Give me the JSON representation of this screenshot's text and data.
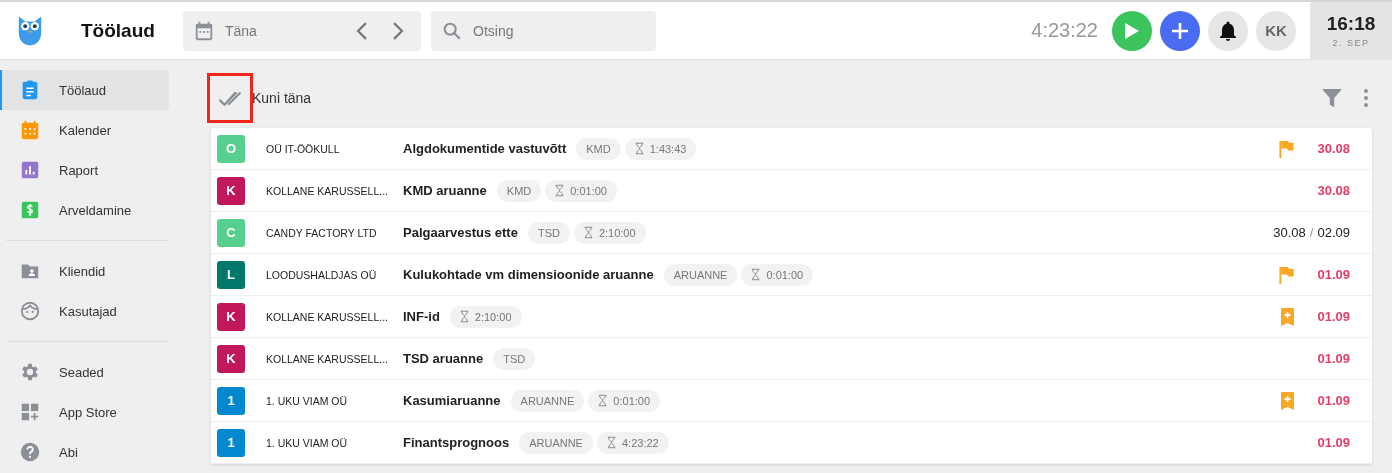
{
  "header": {
    "title": "Töölaud",
    "date_field": {
      "value": "Täna"
    },
    "search": {
      "placeholder": "Otsing"
    },
    "timer": "4:23:22",
    "user_initials": "KK",
    "clock": {
      "time": "16:18",
      "date": "2. SEP"
    }
  },
  "sidebar": {
    "groups": [
      [
        {
          "label": "Töölaud",
          "selected": true
        },
        {
          "label": "Kalender",
          "selected": false
        },
        {
          "label": "Raport",
          "selected": false
        },
        {
          "label": "Arveldamine",
          "selected": false
        }
      ],
      [
        {
          "label": "Kliendid",
          "selected": false
        },
        {
          "label": "Kasutajad",
          "selected": false
        }
      ],
      [
        {
          "label": "Seaded",
          "selected": false
        },
        {
          "label": "App Store",
          "selected": false
        },
        {
          "label": "Abi",
          "selected": false
        }
      ]
    ]
  },
  "toolbar": {
    "label": "Kuni täna",
    "highlighted": true
  },
  "date_separator": "/",
  "tasks": [
    {
      "avatar": "O",
      "color": "#57d08f",
      "client": "OÜ IT-ÖÖKULL",
      "title": "Algdokumentide vastuvõtt",
      "tag": "KMD",
      "duration": "1:43:43",
      "kind": "flagged",
      "dates": [
        "30.08"
      ],
      "overdue": true
    },
    {
      "avatar": "K",
      "color": "#c2185b",
      "client": "KOLLANE KARUSSELL...",
      "title": "KMD aruanne",
      "tag": "KMD",
      "duration": "0:01:00",
      "kind": "plain",
      "dates": [
        "30.08"
      ],
      "overdue": true
    },
    {
      "avatar": "C",
      "color": "#57d08f",
      "client": "CANDY FACTORY LTD",
      "title": "Palgaarvestus ette",
      "tag": "TSD",
      "duration": "2:10:00",
      "kind": "plain",
      "dates": [
        "30.08",
        "02.09"
      ],
      "overdue": false
    },
    {
      "avatar": "L",
      "color": "#00796b",
      "client": "LOODUSHALDJAS OÜ",
      "title": "Kulukohtade vm dimensioonide aruanne",
      "tag": "ARUANNE",
      "duration": "0:01:00",
      "kind": "flagged",
      "dates": [
        "01.09"
      ],
      "overdue": true
    },
    {
      "avatar": "K",
      "color": "#c2185b",
      "client": "KOLLANE KARUSSELL...",
      "title": "INF-id",
      "duration": "2:10:00",
      "kind": "bookmarked",
      "dates": [
        "01.09"
      ],
      "overdue": true
    },
    {
      "avatar": "K",
      "color": "#c2185b",
      "client": "KOLLANE KARUSSELL...",
      "title": "TSD aruanne",
      "tag": "TSD",
      "kind": "plain",
      "dates": [
        "01.09"
      ],
      "overdue": true
    },
    {
      "avatar": "1",
      "color": "#0288d1",
      "client": "1. UKU VIAM OÜ",
      "title": "Kasumiaruanne",
      "tag": "ARUANNE",
      "duration": "0:01:00",
      "kind": "bookmarked",
      "dates": [
        "01.09"
      ],
      "overdue": true
    },
    {
      "avatar": "1",
      "color": "#0288d1",
      "client": "1. UKU VIAM OÜ",
      "title": "Finantsprognoos",
      "tag": "ARUANNE",
      "duration": "4:23:22",
      "kind": "plain",
      "dates": [
        "01.09"
      ],
      "overdue": true
    }
  ]
}
